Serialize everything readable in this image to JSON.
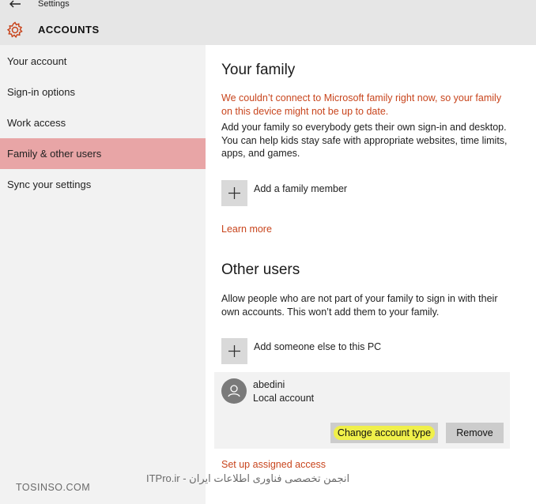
{
  "window": {
    "title": "Settings"
  },
  "header": {
    "section_title": "ACCOUNTS"
  },
  "sidebar": {
    "items": [
      {
        "label": "Your account"
      },
      {
        "label": "Sign-in options"
      },
      {
        "label": "Work access"
      },
      {
        "label": "Family & other users",
        "selected": true
      },
      {
        "label": "Sync your settings"
      }
    ]
  },
  "family": {
    "heading": "Your family",
    "warning": "We couldn’t connect to Microsoft family right now, so your family on this device might not be up to date.",
    "description": "Add your family so everybody gets their own sign-in and desktop. You can help kids stay safe with appropriate websites, time limits, apps, and games.",
    "add_label": "Add a family member",
    "learn_more": "Learn more"
  },
  "other_users": {
    "heading": "Other users",
    "description": "Allow people who are not part of your family to sign in with their own accounts. This won’t add them to your family.",
    "add_label": "Add someone else to this PC",
    "user": {
      "name": "abedini",
      "type": "Local account"
    },
    "change_button": "Change account type",
    "remove_button": "Remove",
    "assigned_access": "Set up assigned access"
  },
  "watermark": {
    "left": "TOSINSO.COM",
    "right": "انجمن تخصصی فناوری اطلاعات ایران - ITPro.ir"
  },
  "colors": {
    "accent": "#c8451d",
    "selected_nav": "#e8a5a6",
    "sidebar_bg": "#f2f2f2",
    "titlebar_bg": "#e6e6e6",
    "button_bg": "#cccccc",
    "highlight": "#f0f04a"
  },
  "icons": [
    "back-arrow-icon",
    "gear-icon",
    "plus-icon",
    "user-avatar-icon"
  ]
}
